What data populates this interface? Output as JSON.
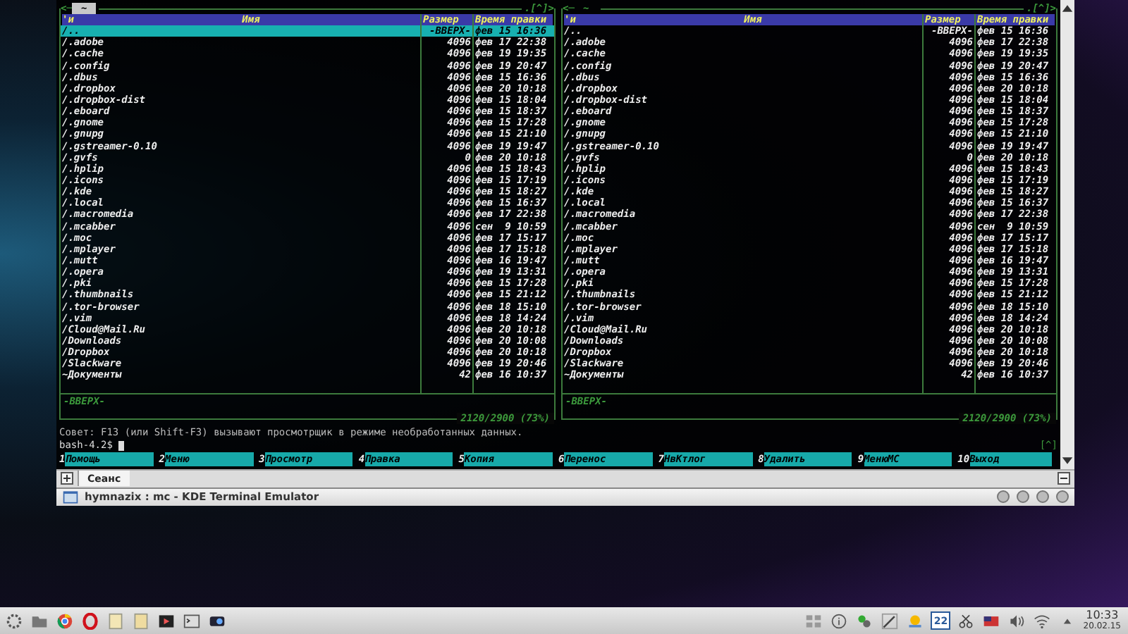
{
  "terminal": {
    "panels": [
      {
        "active": true,
        "top_left": "<─",
        "path": "~",
        "top_right": ".[^]>",
        "columns": [
          "'и",
          "Имя",
          "Размер",
          "Время правки"
        ],
        "footer_status": "-ВВЕРХ-",
        "disk_info": "2120/2900 (73%)",
        "rows": [
          {
            "name": "/..",
            "size": "-ВВЕРХ-",
            "time": "фев 15 16:36",
            "selected": true
          },
          {
            "name": "/.adobe",
            "size": "4096",
            "time": "фев 17 22:38",
            "selected": false
          },
          {
            "name": "/.cache",
            "size": "4096",
            "time": "фев 19 19:35",
            "selected": false
          },
          {
            "name": "/.config",
            "size": "4096",
            "time": "фев 19 20:47",
            "selected": false
          },
          {
            "name": "/.dbus",
            "size": "4096",
            "time": "фев 15 16:36",
            "selected": false
          },
          {
            "name": "/.dropbox",
            "size": "4096",
            "time": "фев 20 10:18",
            "selected": false
          },
          {
            "name": "/.dropbox-dist",
            "size": "4096",
            "time": "фев 15 18:04",
            "selected": false
          },
          {
            "name": "/.eboard",
            "size": "4096",
            "time": "фев 15 18:37",
            "selected": false
          },
          {
            "name": "/.gnome",
            "size": "4096",
            "time": "фев 15 17:28",
            "selected": false
          },
          {
            "name": "/.gnupg",
            "size": "4096",
            "time": "фев 15 21:10",
            "selected": false
          },
          {
            "name": "/.gstreamer-0.10",
            "size": "4096",
            "time": "фев 19 19:47",
            "selected": false
          },
          {
            "name": "/.gvfs",
            "size": "0",
            "time": "фев 20 10:18",
            "selected": false
          },
          {
            "name": "/.hplip",
            "size": "4096",
            "time": "фев 15 18:43",
            "selected": false
          },
          {
            "name": "/.icons",
            "size": "4096",
            "time": "фев 15 17:19",
            "selected": false
          },
          {
            "name": "/.kde",
            "size": "4096",
            "time": "фев 15 18:27",
            "selected": false
          },
          {
            "name": "/.local",
            "size": "4096",
            "time": "фев 15 16:37",
            "selected": false
          },
          {
            "name": "/.macromedia",
            "size": "4096",
            "time": "фев 17 22:38",
            "selected": false
          },
          {
            "name": "/.mcabber",
            "size": "4096",
            "time": "сен  9 10:59",
            "selected": false
          },
          {
            "name": "/.moc",
            "size": "4096",
            "time": "фев 17 15:17",
            "selected": false
          },
          {
            "name": "/.mplayer",
            "size": "4096",
            "time": "фев 17 15:18",
            "selected": false
          },
          {
            "name": "/.mutt",
            "size": "4096",
            "time": "фев 16 19:47",
            "selected": false
          },
          {
            "name": "/.opera",
            "size": "4096",
            "time": "фев 19 13:31",
            "selected": false
          },
          {
            "name": "/.pki",
            "size": "4096",
            "time": "фев 15 17:28",
            "selected": false
          },
          {
            "name": "/.thumbnails",
            "size": "4096",
            "time": "фев 15 21:12",
            "selected": false
          },
          {
            "name": "/.tor-browser",
            "size": "4096",
            "time": "фев 18 15:10",
            "selected": false
          },
          {
            "name": "/.vim",
            "size": "4096",
            "time": "фев 18 14:24",
            "selected": false
          },
          {
            "name": "/Cloud@Mail.Ru",
            "size": "4096",
            "time": "фев 20 10:18",
            "selected": false
          },
          {
            "name": "/Downloads",
            "size": "4096",
            "time": "фев 20 10:08",
            "selected": false
          },
          {
            "name": "/Dropbox",
            "size": "4096",
            "time": "фев 20 10:18",
            "selected": false
          },
          {
            "name": "/Slackware",
            "size": "4096",
            "time": "фев 19 20:46",
            "selected": false
          },
          {
            "name": "~Документы",
            "size": "42",
            "time": "фев 16 10:37",
            "selected": false
          }
        ]
      },
      {
        "active": false,
        "top_left": "<─",
        "path": "~",
        "top_right": ".[^]>",
        "columns": [
          "'и",
          "Имя",
          "Размер",
          "Время правки"
        ],
        "footer_status": "-ВВЕРХ-",
        "disk_info": "2120/2900 (73%)",
        "rows": [
          {
            "name": "/..",
            "size": "-ВВЕРХ-",
            "time": "фев 15 16:36",
            "selected": false
          },
          {
            "name": "/.adobe",
            "size": "4096",
            "time": "фев 17 22:38",
            "selected": false
          },
          {
            "name": "/.cache",
            "size": "4096",
            "time": "фев 19 19:35",
            "selected": false
          },
          {
            "name": "/.config",
            "size": "4096",
            "time": "фев 19 20:47",
            "selected": false
          },
          {
            "name": "/.dbus",
            "size": "4096",
            "time": "фев 15 16:36",
            "selected": false
          },
          {
            "name": "/.dropbox",
            "size": "4096",
            "time": "фев 20 10:18",
            "selected": false
          },
          {
            "name": "/.dropbox-dist",
            "size": "4096",
            "time": "фев 15 18:04",
            "selected": false
          },
          {
            "name": "/.eboard",
            "size": "4096",
            "time": "фев 15 18:37",
            "selected": false
          },
          {
            "name": "/.gnome",
            "size": "4096",
            "time": "фев 15 17:28",
            "selected": false
          },
          {
            "name": "/.gnupg",
            "size": "4096",
            "time": "фев 15 21:10",
            "selected": false
          },
          {
            "name": "/.gstreamer-0.10",
            "size": "4096",
            "time": "фев 19 19:47",
            "selected": false
          },
          {
            "name": "/.gvfs",
            "size": "0",
            "time": "фев 20 10:18",
            "selected": false
          },
          {
            "name": "/.hplip",
            "size": "4096",
            "time": "фев 15 18:43",
            "selected": false
          },
          {
            "name": "/.icons",
            "size": "4096",
            "time": "фев 15 17:19",
            "selected": false
          },
          {
            "name": "/.kde",
            "size": "4096",
            "time": "фев 15 18:27",
            "selected": false
          },
          {
            "name": "/.local",
            "size": "4096",
            "time": "фев 15 16:37",
            "selected": false
          },
          {
            "name": "/.macromedia",
            "size": "4096",
            "time": "фев 17 22:38",
            "selected": false
          },
          {
            "name": "/.mcabber",
            "size": "4096",
            "time": "сен  9 10:59",
            "selected": false
          },
          {
            "name": "/.moc",
            "size": "4096",
            "time": "фев 17 15:17",
            "selected": false
          },
          {
            "name": "/.mplayer",
            "size": "4096",
            "time": "фев 17 15:18",
            "selected": false
          },
          {
            "name": "/.mutt",
            "size": "4096",
            "time": "фев 16 19:47",
            "selected": false
          },
          {
            "name": "/.opera",
            "size": "4096",
            "time": "фев 19 13:31",
            "selected": false
          },
          {
            "name": "/.pki",
            "size": "4096",
            "time": "фев 15 17:28",
            "selected": false
          },
          {
            "name": "/.thumbnails",
            "size": "4096",
            "time": "фев 15 21:12",
            "selected": false
          },
          {
            "name": "/.tor-browser",
            "size": "4096",
            "time": "фев 18 15:10",
            "selected": false
          },
          {
            "name": "/.vim",
            "size": "4096",
            "time": "фев 18 14:24",
            "selected": false
          },
          {
            "name": "/Cloud@Mail.Ru",
            "size": "4096",
            "time": "фев 20 10:18",
            "selected": false
          },
          {
            "name": "/Downloads",
            "size": "4096",
            "time": "фев 20 10:08",
            "selected": false
          },
          {
            "name": "/Dropbox",
            "size": "4096",
            "time": "фев 20 10:18",
            "selected": false
          },
          {
            "name": "/Slackware",
            "size": "4096",
            "time": "фев 19 20:46",
            "selected": false
          },
          {
            "name": "~Документы",
            "size": "42",
            "time": "фев 16 10:37",
            "selected": false
          }
        ]
      }
    ],
    "hint": "Совет: F13 (или Shift-F3) вызывают просмотрщик в режиме необработанных данных.",
    "prompt": "bash-4.2$",
    "corner_mark": "[^]",
    "function_keys": [
      {
        "number": "1",
        "label": "Помощь"
      },
      {
        "number": "2",
        "label": "Меню"
      },
      {
        "number": "3",
        "label": "Просмотр"
      },
      {
        "number": "4",
        "label": "Правка"
      },
      {
        "number": "5",
        "label": "Копия"
      },
      {
        "number": "6",
        "label": "Перенос"
      },
      {
        "number": "7",
        "label": "НвКтлог"
      },
      {
        "number": "8",
        "label": "Удалить"
      },
      {
        "number": "9",
        "label": "МенюМС"
      },
      {
        "number": "10",
        "label": "Выход"
      }
    ]
  },
  "tab_bar": {
    "tabs": [
      {
        "label": "Сеанс",
        "selected": true
      }
    ]
  },
  "window_title": "hymnazix : mc - KDE Terminal Emulator",
  "taskbar": {
    "calendar_day": "22",
    "clock": "10:33",
    "date": "20.02.15"
  }
}
